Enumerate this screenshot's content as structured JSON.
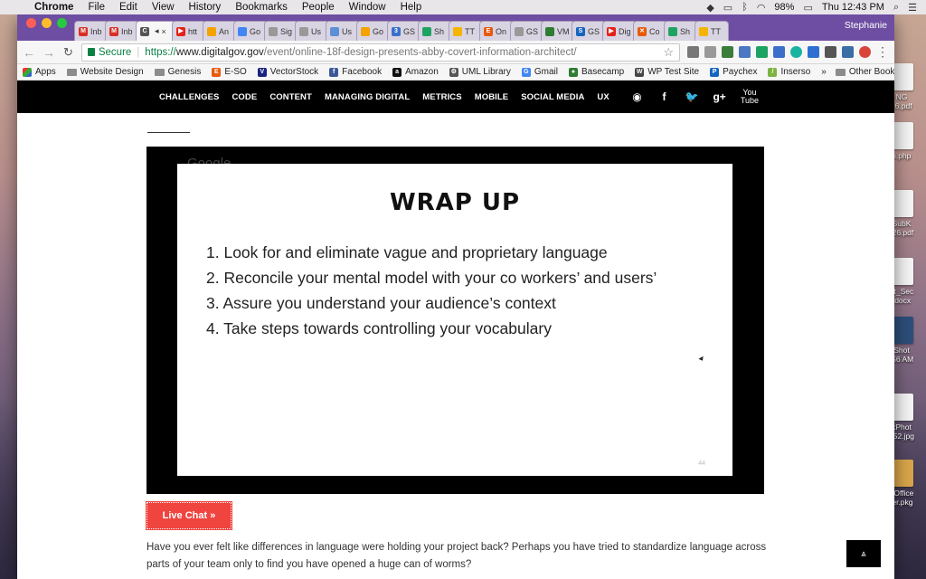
{
  "menubar": {
    "app": "Chrome",
    "items": [
      "File",
      "Edit",
      "View",
      "History",
      "Bookmarks",
      "People",
      "Window",
      "Help"
    ],
    "battery": "98%",
    "clock": "Thu 12:43 PM"
  },
  "browser": {
    "profile": "Stephanie",
    "tabs": [
      {
        "label": "Inb",
        "color": "#d93025",
        "glyph": "M"
      },
      {
        "label": "Inb",
        "color": "#d93025",
        "glyph": "M"
      },
      {
        "label": "",
        "color": "#555555",
        "glyph": "C",
        "active": true
      },
      {
        "label": "htt",
        "color": "#e62117",
        "glyph": "▶"
      },
      {
        "label": "An",
        "color": "#f4a300",
        "glyph": ""
      },
      {
        "label": "Go",
        "color": "#4285f4",
        "glyph": ""
      },
      {
        "label": "Sig",
        "color": "#999999",
        "glyph": ""
      },
      {
        "label": "Us",
        "color": "#999999",
        "glyph": ""
      },
      {
        "label": "Us",
        "color": "#5b8fd6",
        "glyph": ""
      },
      {
        "label": "Go",
        "color": "#f4a300",
        "glyph": ""
      },
      {
        "label": "GS",
        "color": "#3b6fc9",
        "glyph": "3"
      },
      {
        "label": "Sh",
        "color": "#1ea362",
        "glyph": ""
      },
      {
        "label": "TT",
        "color": "#f4b400",
        "glyph": ""
      },
      {
        "label": "On",
        "color": "#e8590c",
        "glyph": "E"
      },
      {
        "label": "GS",
        "color": "#999999",
        "glyph": ""
      },
      {
        "label": "VM",
        "color": "#2e7d32",
        "glyph": ""
      },
      {
        "label": "GS",
        "color": "#1565c0",
        "glyph": "S"
      },
      {
        "label": "Dig",
        "color": "#e62117",
        "glyph": "▶"
      },
      {
        "label": "Co",
        "color": "#e8590c",
        "glyph": "✕"
      },
      {
        "label": "Sh",
        "color": "#1ea362",
        "glyph": ""
      },
      {
        "label": "TT",
        "color": "#f4b400",
        "glyph": ""
      }
    ],
    "secure_label": "Secure",
    "url_scheme": "https://",
    "url_host": "www.digitalgov.gov",
    "url_path": "/event/online-18f-design-presents-abby-covert-information-architect/",
    "bookmarks": [
      {
        "label": "Apps",
        "kind": "apps"
      },
      {
        "label": "Website Design",
        "kind": "folder"
      },
      {
        "label": "Genesis",
        "kind": "folder"
      },
      {
        "label": "E-SO",
        "kind": "icon",
        "color": "#e8590c",
        "glyph": "E"
      },
      {
        "label": "VectorStock",
        "kind": "icon",
        "color": "#1a237e",
        "glyph": "V"
      },
      {
        "label": "Facebook",
        "kind": "icon",
        "color": "#3b5998",
        "glyph": "f"
      },
      {
        "label": "Amazon",
        "kind": "icon",
        "color": "#111111",
        "glyph": "a"
      },
      {
        "label": "UML Library",
        "kind": "icon",
        "color": "#555555",
        "glyph": "⚙"
      },
      {
        "label": "Gmail",
        "kind": "icon",
        "color": "#4285f4",
        "glyph": "G"
      },
      {
        "label": "Basecamp",
        "kind": "icon",
        "color": "#2e7d32",
        "glyph": "●"
      },
      {
        "label": "WP Test Site",
        "kind": "icon",
        "color": "#464646",
        "glyph": "W"
      },
      {
        "label": "Paychex",
        "kind": "icon",
        "color": "#1565c0",
        "glyph": "P"
      },
      {
        "label": "Inserso",
        "kind": "icon",
        "color": "#7cb342",
        "glyph": "/"
      }
    ],
    "more_bookmarks": "»",
    "other_bookmarks": "Other Bookmarks"
  },
  "site": {
    "nav": [
      "CHALLENGES",
      "CODE",
      "CONTENT",
      "MANAGING DIGITAL",
      "METRICS",
      "MOBILE",
      "SOCIAL MEDIA",
      "UX"
    ],
    "social_icons": [
      "rss-icon",
      "facebook-icon",
      "twitter-icon",
      "google-plus-icon",
      "youtube-icon"
    ]
  },
  "video": {
    "watermark": "Google",
    "slide_title": "Wrap up",
    "slide_items": [
      "1. Look for and eliminate vague and proprietary language",
      "2. Reconcile your mental model with your co workers’ and users’",
      "3. Assure you understand your audience’s context",
      "4. Take steps towards controlling your vocabulary"
    ],
    "slide_number": "44"
  },
  "live_chat_label": "Live Chat »",
  "body_text": "Have you ever felt like differences in language were holding your project back? Perhaps you have tried to standardize language across parts of your team only to find you have opened a huge can of worms?",
  "desktop_icons": [
    {
      "label": "NG\nk6.pdf",
      "kind": "doc"
    },
    {
      "label": "s.php",
      "kind": "doc"
    },
    {
      "label": "SubK\n-26.pdf",
      "kind": "doc"
    },
    {
      "label": "ht_Sec\n.docx",
      "kind": "doc"
    },
    {
      "label": "Shot\n.56 AM",
      "kind": "img"
    },
    {
      "label": "kPhot\n052.jpg",
      "kind": "doc"
    },
    {
      "label": "_Office\nler.pkg",
      "kind": "pkg"
    }
  ]
}
